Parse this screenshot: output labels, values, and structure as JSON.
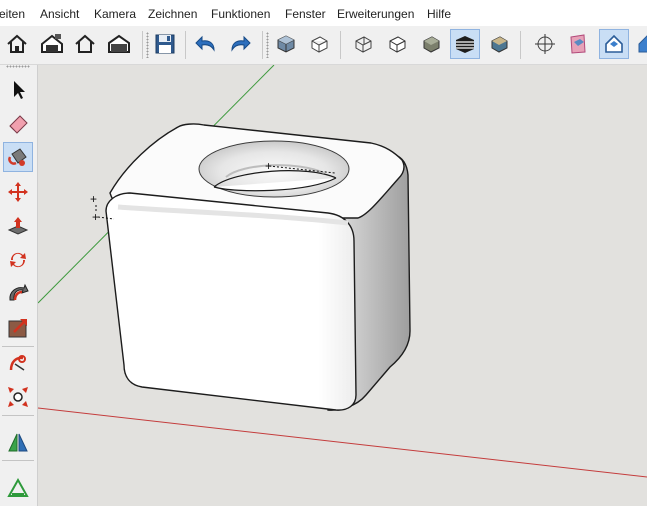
{
  "menu": {
    "items": [
      "eiten",
      "Ansicht",
      "Kamera",
      "Zeichnen",
      "Funktionen",
      "Fenster",
      "Erweiterungen",
      "Hilfe"
    ]
  },
  "toolbar": {
    "buttons": [
      "home-icon",
      "save-as-template-icon",
      "house-outline-icon",
      "open-model-icon",
      "floppy-save-icon",
      "undo-icon",
      "redo-icon",
      "shaded-cube-icon",
      "wireframe-cube-icon",
      "xray-cube-icon",
      "hidden-line-cube-icon",
      "shaded-solid-cube-icon",
      "shaded-texture-cube-icon",
      "monochrome-cube-icon",
      "axes-icon",
      "section-plane-icon",
      "house-view-icon",
      "house-view-2-icon"
    ],
    "active": [
      "monochrome-cube-icon",
      "house-view-icon"
    ]
  },
  "sidebar": {
    "tools": [
      "select-arrow-icon",
      "eraser-icon",
      "paint-bucket-icon",
      "move-icon",
      "push-pull-icon",
      "rotate-icon",
      "follow-me-icon",
      "scale-icon",
      "tape-measure-icon",
      "zoom-extents-icon",
      "section-plane-tool-icon",
      "axes-tool-icon"
    ],
    "active": "paint-bucket-icon"
  },
  "viewport": {
    "background_color": "#e2e1de",
    "axis_colors": {
      "green": "#3e9a3e",
      "red": "#c43c3c"
    },
    "model": "rounded cube with spherical hole on top face"
  }
}
